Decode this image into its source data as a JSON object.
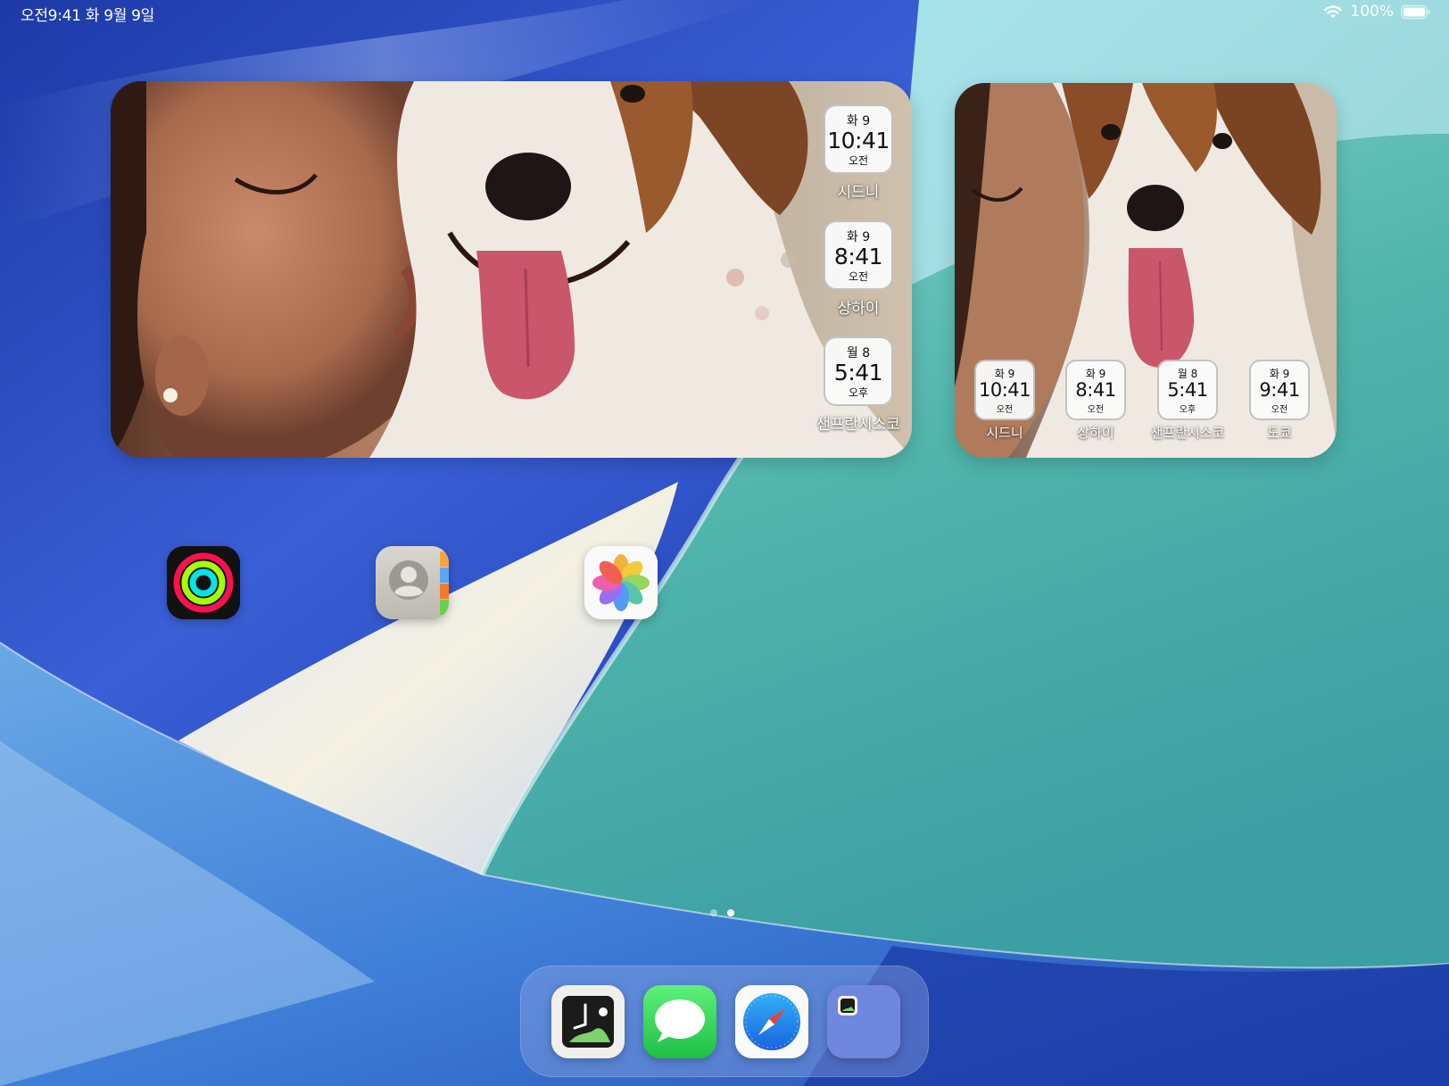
{
  "status_bar": {
    "time_date": "오전9:41 화 9월 9일",
    "battery": "100%"
  },
  "widget_large": {
    "clocks": [
      {
        "date": "화 9",
        "time": "10:41",
        "ampm": "오전",
        "city": "시드니"
      },
      {
        "date": "화 9",
        "time": "8:41",
        "ampm": "오전",
        "city": "상하이"
      },
      {
        "date": "월 8",
        "time": "5:41",
        "ampm": "오후",
        "city": "샌프란시스코"
      }
    ]
  },
  "widget_small": {
    "clocks": [
      {
        "date": "화 9",
        "time": "10:41",
        "ampm": "오전",
        "city": "시드니"
      },
      {
        "date": "화 9",
        "time": "8:41",
        "ampm": "오전",
        "city": "상하이"
      },
      {
        "date": "월 8",
        "time": "5:41",
        "ampm": "오후",
        "city": "샌프란시스코"
      },
      {
        "date": "화 9",
        "time": "9:41",
        "ampm": "오전",
        "city": "도쿄"
      }
    ]
  },
  "home_apps": [
    "activity-icon",
    "contacts-icon",
    "photos-icon"
  ],
  "dock_apps": [
    "clock-photo-app-icon",
    "messages-icon",
    "safari-icon",
    "app-folder-icon"
  ],
  "page_indicator": {
    "count": 2,
    "current": 2
  },
  "colors": {
    "wallpaper_blue": "#2f4fc4",
    "wallpaper_teal": "#4fb7ac",
    "wallpaper_cream": "#efeede"
  }
}
